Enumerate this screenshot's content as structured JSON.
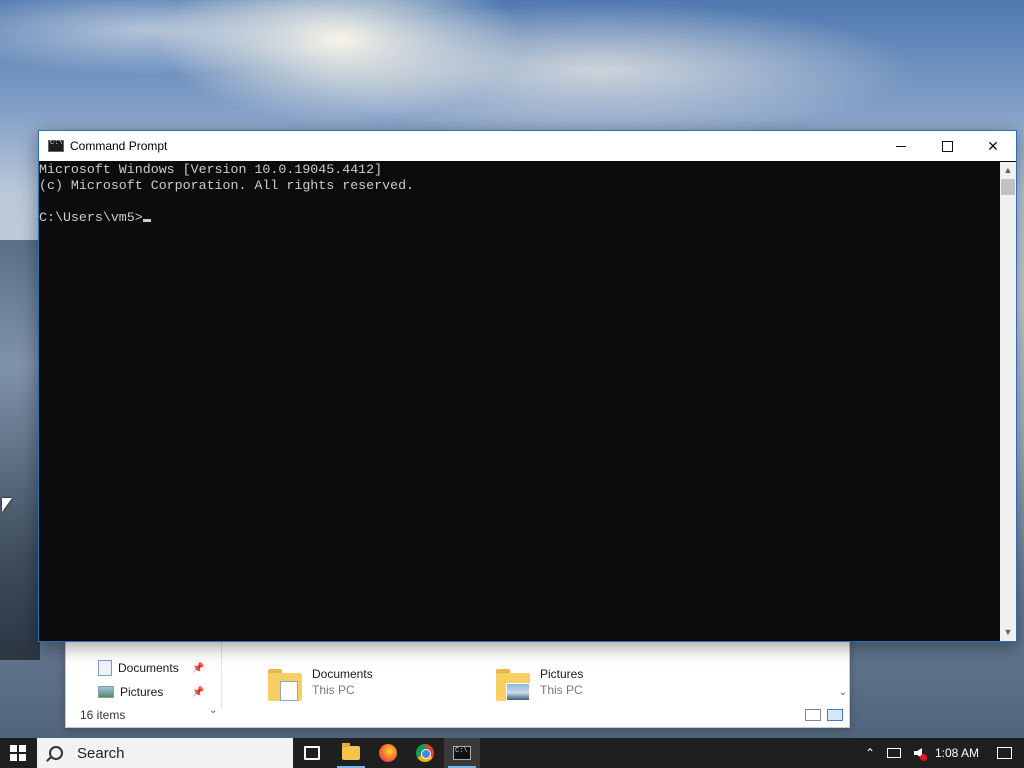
{
  "explorer": {
    "nav_items": [
      {
        "label": "Documents",
        "icon": "documents-icon"
      },
      {
        "label": "Pictures",
        "icon": "pictures-icon"
      }
    ],
    "tiles": [
      {
        "name": "Documents",
        "location": "This PC"
      },
      {
        "name": "Pictures",
        "location": "This PC"
      }
    ],
    "status": "16 items"
  },
  "cmd": {
    "title": "Command Prompt",
    "lines": [
      "Microsoft Windows [Version 10.0.19045.4412]",
      "(c) Microsoft Corporation. All rights reserved.",
      "",
      "C:\\Users\\vm5>"
    ]
  },
  "taskbar": {
    "search_placeholder": "Search",
    "apps": [
      "task-view",
      "file-explorer",
      "firefox",
      "chrome",
      "command-prompt"
    ],
    "active_app": "command-prompt",
    "clock": "1:08 AM"
  }
}
